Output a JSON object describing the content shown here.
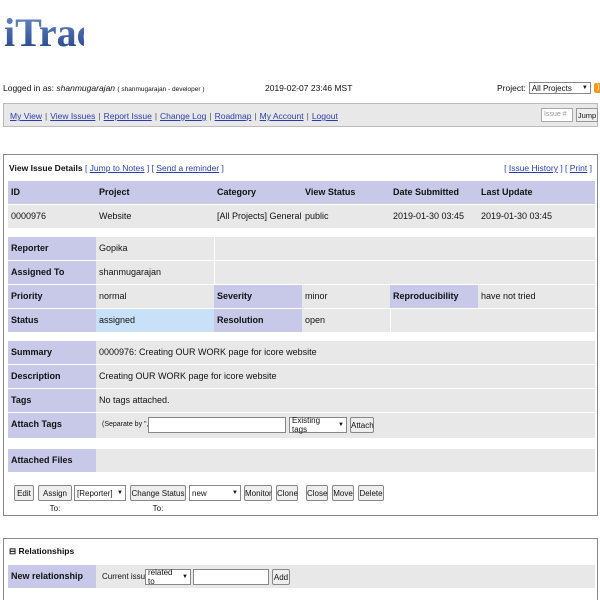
{
  "app": {
    "logo_text": "iTrack"
  },
  "login": {
    "prefix": "Logged in as:",
    "username": "shanmugarajan",
    "role": "( shanmugarajan - developer )",
    "datetime": "2019-02-07 23:46 MST",
    "project_label": "Project:",
    "project_value": "All Projects"
  },
  "menu": {
    "items": [
      "My View",
      "View Issues",
      "Report Issue",
      "Change Log",
      "Roadmap",
      "My Account",
      "Logout"
    ],
    "issue_placeholder": "Issue #",
    "jump_label": "Jump"
  },
  "details": {
    "title": "View Issue Details",
    "jump_to_notes": "Jump to Notes",
    "send_reminder": "Send a reminder",
    "issue_history": "Issue History",
    "print": "Print",
    "columns": [
      "ID",
      "Project",
      "Category",
      "View Status",
      "Date Submitted",
      "Last Update"
    ],
    "values": [
      "0000976",
      "Website",
      "[All Projects] General",
      "public",
      "2019-01-30 03:45",
      "2019-01-30 03:45"
    ],
    "reporter_label": "Reporter",
    "reporter": "Gopika",
    "assigned_label": "Assigned To",
    "assigned": "shanmugarajan",
    "priority_label": "Priority",
    "priority": "normal",
    "severity_label": "Severity",
    "severity": "minor",
    "repro_label": "Reproducibility",
    "repro": "have not tried",
    "status_label": "Status",
    "status": "assigned",
    "resolution_label": "Resolution",
    "resolution": "open",
    "summary_label": "Summary",
    "summary": "0000976: Creating OUR WORK page for icore website",
    "description_label": "Description",
    "description": "Creating OUR WORK page for icore website",
    "tags_label": "Tags",
    "tags": "No tags attached.",
    "attach_tags_label": "Attach Tags",
    "separate_hint": "(Separate by \",\")",
    "existing_tags": "Existing tags",
    "attach_button": "Attach",
    "attached_files_label": "Attached Files"
  },
  "actions": {
    "edit": "Edit",
    "assign_to": "Assign To:",
    "assign_value": "[Reporter]",
    "change_status": "Change Status To:",
    "status_value": "new",
    "monitor": "Monitor",
    "clone": "Clone",
    "close": "Close",
    "move": "Move",
    "delete": "Delete"
  },
  "relationships": {
    "title": "Relationships",
    "toggle": "⊟",
    "new_label": "New relationship",
    "current_issue": "Current issue",
    "relation_value": "related to",
    "add": "Add"
  },
  "colors": {
    "header_bg": "#c8c8e8",
    "light_bg": "#e8e8e8",
    "status_bg": "#c8e0f8",
    "link": "#2b3ea8"
  }
}
